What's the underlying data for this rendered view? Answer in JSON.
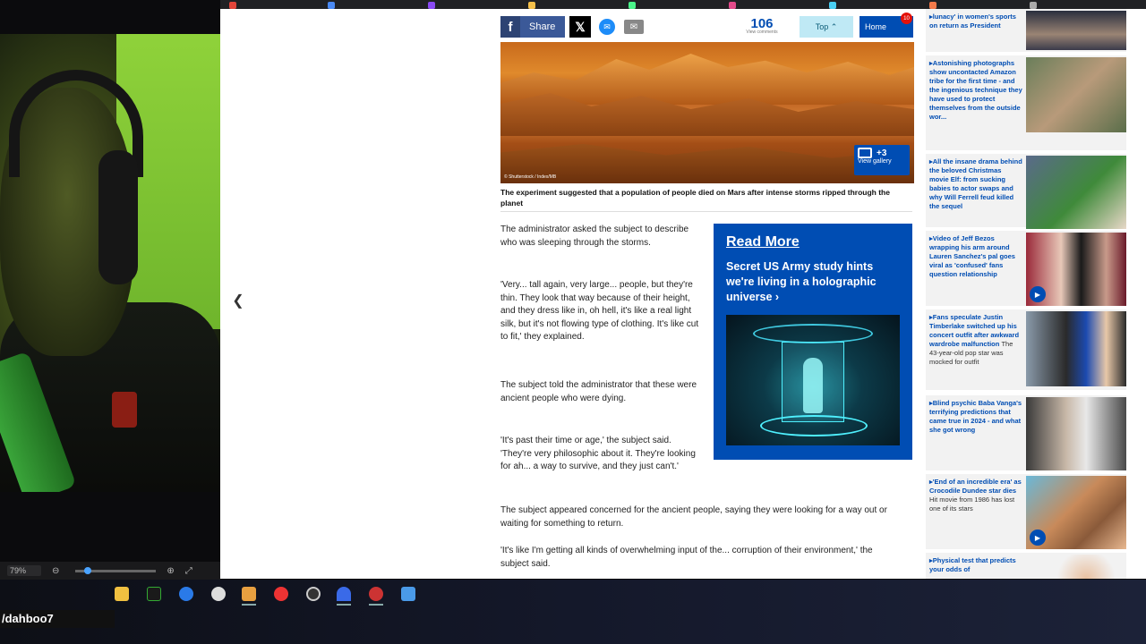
{
  "zoom": {
    "percent": "79%",
    "minus": "⊖",
    "plus": "⊕",
    "expand": "⤢"
  },
  "share_bar": {
    "facebook_label": "Share",
    "comments_count": "106",
    "comments_label": "View comments",
    "top_label": "Top",
    "home_label": "Home",
    "home_badge": "10"
  },
  "hero": {
    "gallery_count": "+3",
    "gallery_label": "View gallery",
    "credit": "© Shutterstock / Index/MB"
  },
  "caption": "The experiment suggested that a population of people died on Mars after intense storms ripped through the planet",
  "paragraphs": [
    "The administrator asked the subject to describe who was sleeping through the storms.",
    "'Very... tall again, very large... people, but they're thin. They look that way because of their height, and they dress like in, oh hell, it's like a real light silk, but it's not flowing type of clothing. It's like cut to fit,' they explained.",
    "The subject told the administrator that these were ancient people who were dying.",
    "'It's past their time or age,' the subject said. 'They're very philosophic about it. They're looking for ah... a way to survive, and they just can't.'",
    "The subject appeared concerned for the ancient people, saying they were looking for a way out or waiting for something to return.",
    "'It's like I'm getting all kinds of overwhelming input of the... corruption of their environment,' the subject said."
  ],
  "read_more": {
    "title": "Read More",
    "text": "Secret US Army study hints we're living in a holographic universe ›"
  },
  "sidebar": [
    {
      "headline": "lunacy' in women's sports on return as President",
      "sub": ""
    },
    {
      "headline": "Astonishing photographs show uncontacted Amazon tribe for the first time - and the ingenious technique they have used to protect themselves from the outside wor...",
      "sub": ""
    },
    {
      "headline": "All the insane drama behind the beloved Christmas movie Elf: from sucking babies to actor swaps and why Will Ferrell feud killed the sequel",
      "sub": ""
    },
    {
      "headline": "Video of Jeff Bezos wrapping his arm around Lauren Sanchez's pal goes viral as 'confused' fans question relationship",
      "sub": ""
    },
    {
      "headline": "Fans speculate Justin Timberlake switched up his concert outfit after awkward wardrobe malfunction",
      "sub": "The 43-year-old pop star was mocked for outfit"
    },
    {
      "headline": "Blind psychic Baba Vanga's terrifying predictions that came true in 2024 - and what she got wrong",
      "sub": ""
    },
    {
      "headline": "'End of an incredible era' as Crocodile Dundee star dies",
      "sub": "Hit movie from 1986 has lost one of its stars"
    },
    {
      "headline": "Physical test that predicts your odds of",
      "sub": ""
    }
  ],
  "channel": "/dahboo7",
  "colors": {
    "brand_blue": "#004db3",
    "page_bg": "#ffffff",
    "green_screen": "#6fb52c"
  }
}
